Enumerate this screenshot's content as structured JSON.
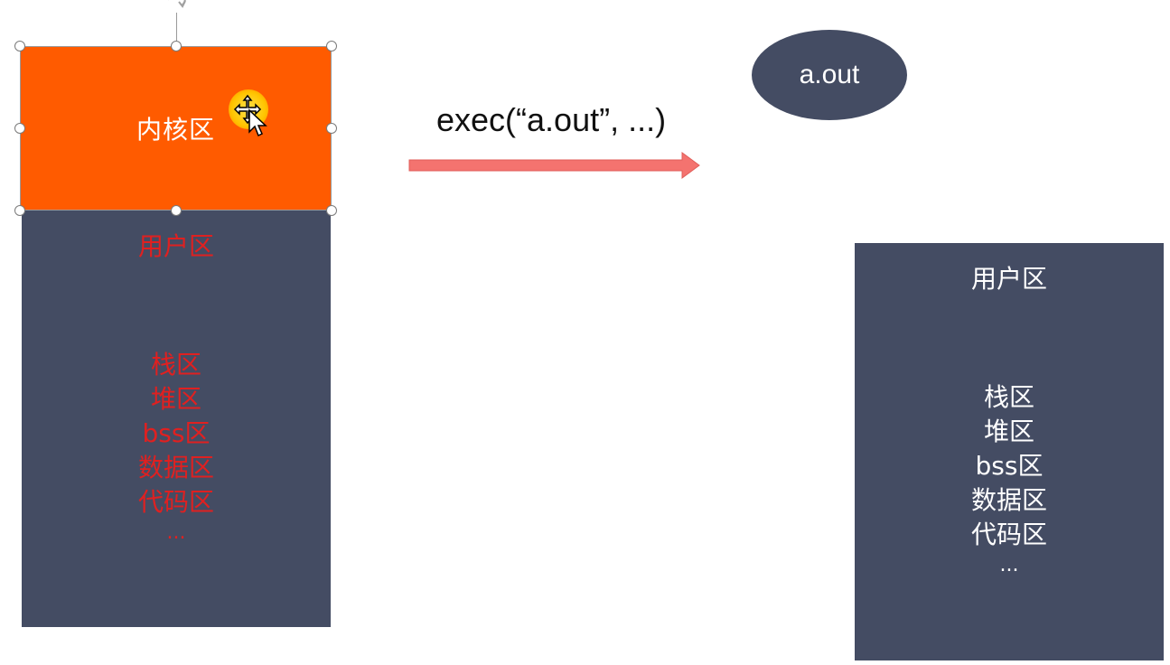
{
  "left_process": {
    "kernel_label": "内核区",
    "user_title": "用户区",
    "segments": [
      "栈区",
      "堆区",
      "bss区",
      "数据区",
      "代码区",
      "..."
    ]
  },
  "exec_call": {
    "label": "exec(“a.out”, ...)"
  },
  "program": {
    "label": "a.out"
  },
  "right_process": {
    "user_title": "用户区",
    "segments": [
      "栈区",
      "堆区",
      "bss区",
      "数据区",
      "代码区",
      "..."
    ]
  },
  "colors": {
    "kernel": "#ff5b00",
    "box": "#444c63",
    "highlight_text": "#e02020",
    "arrow": "#f4736f"
  },
  "icons": {
    "cursor": "move-cursor-icon",
    "rotate": "rotate-handle-icon"
  }
}
